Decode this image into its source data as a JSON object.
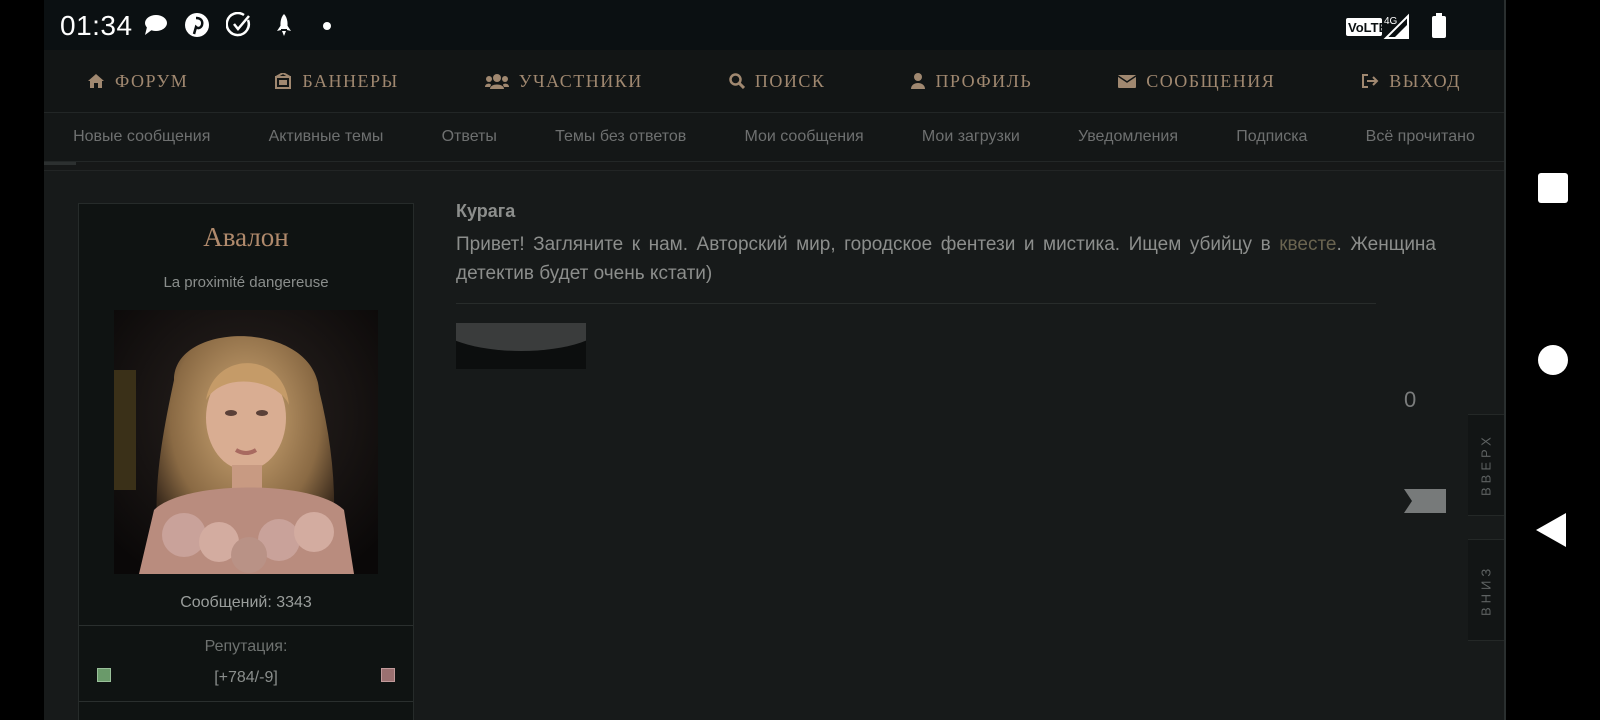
{
  "status_bar": {
    "time": "01:34",
    "icons": [
      "chat-bubble-icon",
      "pinterest-icon",
      "check-circle-icon",
      "rocket-icon",
      "dot-icon"
    ],
    "volte": "VoLTE",
    "network": "4G"
  },
  "main_nav": [
    {
      "label": "ФОРУМ",
      "icon": "home-icon"
    },
    {
      "label": "БАННЕРЫ",
      "icon": "banner-icon"
    },
    {
      "label": "УЧАСТНИКИ",
      "icon": "users-icon"
    },
    {
      "label": "ПОИСК",
      "icon": "search-icon"
    },
    {
      "label": "ПРОФИЛЬ",
      "icon": "user-icon"
    },
    {
      "label": "СООБЩЕНИЯ",
      "icon": "envelope-icon"
    },
    {
      "label": "ВЫХОД",
      "icon": "logout-icon"
    }
  ],
  "sub_nav": [
    "Новые сообщения",
    "Активные темы",
    "Ответы",
    "Темы без ответов",
    "Мои сообщения",
    "Мои загрузки",
    "Уведомления",
    "Подписка",
    "Всё прочитано"
  ],
  "profile": {
    "name": "Авалон",
    "subtitle": "La proximité dangereuse",
    "posts": "Сообщений: 3343",
    "reputation_label": "Репутация:",
    "reputation_value": "[+784/-9]"
  },
  "post": {
    "author": "Курага",
    "text_before": "Привет! Загляните к нам. Авторский мир, городское фентези и мистика. Ищем убийцу в ",
    "link": "квесте",
    "text_after": ". Женщина детектив будет очень кстати)",
    "count": "0"
  },
  "side_buttons": {
    "up": "ВВЕРХ",
    "down": "ВНИЗ"
  },
  "colors": {
    "nav_text": "#a08870",
    "name": "#b08a6c",
    "background": "#161818"
  }
}
